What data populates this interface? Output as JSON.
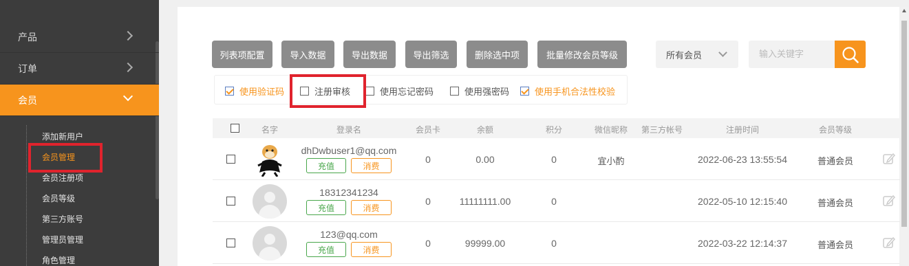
{
  "sidebar": {
    "groups": [
      {
        "label": "产品"
      },
      {
        "label": "订单"
      },
      {
        "label": "会员"
      }
    ],
    "sub_items": [
      {
        "label": "添加新用户"
      },
      {
        "label": "会员管理"
      },
      {
        "label": "会员注册项"
      },
      {
        "label": "会员等级"
      },
      {
        "label": "第三方账号"
      },
      {
        "label": "管理员管理"
      },
      {
        "label": "角色管理"
      }
    ]
  },
  "toolbar": {
    "buttons": [
      {
        "label": "列表项配置"
      },
      {
        "label": "导入数据"
      },
      {
        "label": "导出数据"
      },
      {
        "label": "导出筛选"
      },
      {
        "label": "删除选中项"
      },
      {
        "label": "批量修改会员等级"
      }
    ],
    "member_filter": "所有会员",
    "search_placeholder": "输入关键字"
  },
  "options": [
    {
      "label": "使用验证码",
      "checked": true
    },
    {
      "label": "注册审核",
      "checked": false
    },
    {
      "label": "使用忘记密码",
      "checked": false
    },
    {
      "label": "使用强密码",
      "checked": false
    },
    {
      "label": "使用手机合法性校验",
      "checked": true
    }
  ],
  "table": {
    "columns": [
      "名字",
      "登录名",
      "会员卡",
      "余额",
      "积分",
      "微信昵称",
      "第三方帐号",
      "注册时间",
      "会员等级"
    ],
    "charge_label": "充值",
    "consume_label": "消费",
    "rows": [
      {
        "login": "dhDwbuser1@qq.com",
        "card": "0",
        "balance": "0.00",
        "points": "0",
        "wechat": "宜小酌",
        "third": "",
        "registered": "2022-06-23 13:55:54",
        "level": "普通会员",
        "avatar": "custom"
      },
      {
        "login": "18312341234",
        "card": "0",
        "balance": "11111111.00",
        "points": "0",
        "wechat": "",
        "third": "",
        "registered": "2022-05-10 12:15:40",
        "level": "普通会员",
        "avatar": "default"
      },
      {
        "login": "123@qq.com",
        "card": "0",
        "balance": "99999.00",
        "points": "0",
        "wechat": "",
        "third": "",
        "registered": "2022-03-22 12:14:37",
        "level": "普通会员",
        "avatar": "default"
      }
    ]
  },
  "colors": {
    "accent": "#f7941d",
    "highlight_box": "#e0232d",
    "sidebar_bg": "#3c3c3c",
    "charge_green": "#48a64a"
  }
}
